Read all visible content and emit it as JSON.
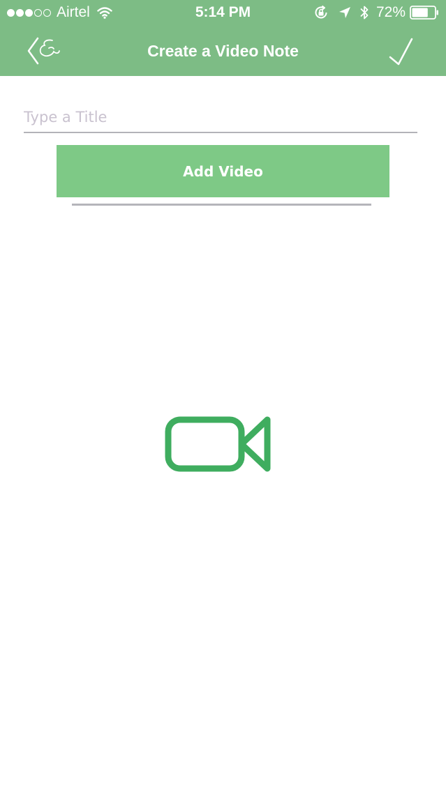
{
  "status_bar": {
    "carrier": "Airtel",
    "time": "5:14 PM",
    "battery_percent": "72%",
    "battery_level": 0.72,
    "signal_bars_filled": 3,
    "signal_bars_total": 5,
    "icons": [
      "wifi-icon",
      "rotation-lock-icon",
      "location-icon",
      "bluetooth-icon",
      "battery-icon"
    ]
  },
  "nav": {
    "title": "Create a Video Note",
    "back_icon": "back-chevron-icon",
    "done_icon": "checkmark-icon"
  },
  "form": {
    "title_value": "",
    "title_placeholder": "Type a Title",
    "add_video_label": "Add Video"
  },
  "media": {
    "icon": "video-camera-icon"
  },
  "colors": {
    "header_green": "#7dbc85",
    "button_green": "#7ec986",
    "icon_green": "#3fad5f",
    "divider_gray": "#b5b5ba"
  }
}
